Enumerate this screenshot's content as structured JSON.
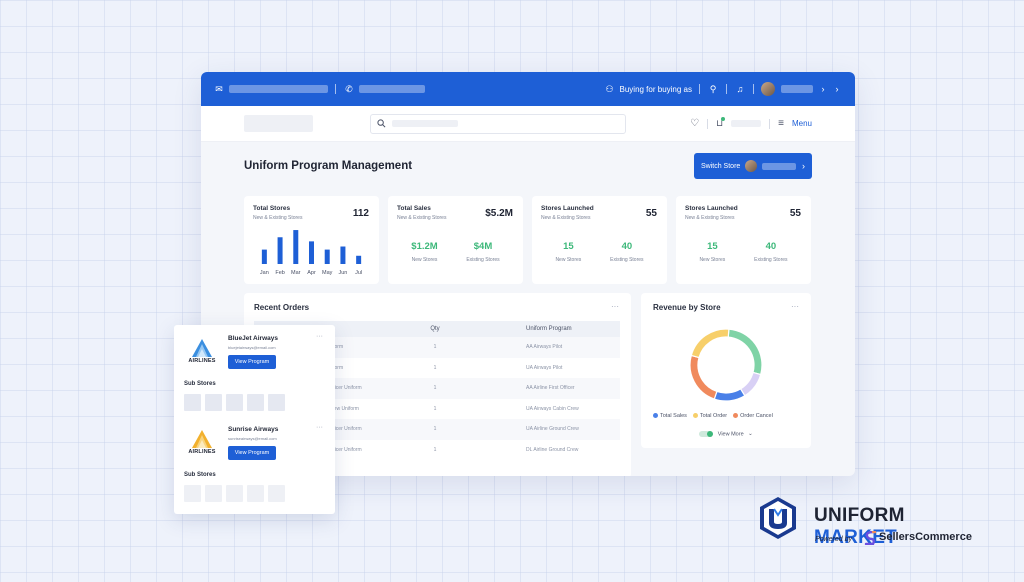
{
  "topbar": {
    "buying_for": "Buying for buying as"
  },
  "navbar": {
    "menu_label": "Menu"
  },
  "page": {
    "title": "Uniform Program Management",
    "switch_store_label": "Switch Store"
  },
  "kpis": [
    {
      "title": "Total Stores",
      "subtitle": "New & Existing Stores",
      "value": "112"
    },
    {
      "title": "Total Sales",
      "subtitle": "New & Existing Stores",
      "value": "$5.2M",
      "left_num": "$1.2M",
      "left_label": "New Stores",
      "right_num": "$4M",
      "right_label": "Existing Stores"
    },
    {
      "title": "Stores Launched",
      "subtitle": "New & Existing Stores",
      "value": "55",
      "left_num": "15",
      "left_label": "New Stores",
      "right_num": "40",
      "right_label": "Existing Stores"
    },
    {
      "title": "Stores Launched",
      "subtitle": "New & Existing Stores",
      "value": "55",
      "left_num": "15",
      "left_label": "New Stores",
      "right_num": "40",
      "right_label": "Existing Stores"
    }
  ],
  "chart_data": [
    {
      "type": "bar",
      "categories": [
        "Jan",
        "Feb",
        "Mar",
        "Apr",
        "May",
        "Jun",
        "Jul"
      ],
      "values": [
        14,
        26,
        33,
        22,
        14,
        17,
        8
      ],
      "ylim": [
        0,
        35
      ]
    },
    {
      "type": "pie",
      "categories": [
        "Total Sales",
        "Total Order",
        "Order Cancel"
      ],
      "legend_placement": "bottom",
      "segments": [
        {
          "color": "#7fd3a6",
          "value": 28
        },
        {
          "color": "#d8d0f5",
          "value": 12
        },
        {
          "color": "#4a80e8",
          "value": 14
        },
        {
          "color": "#f08a5d",
          "value": 24
        },
        {
          "color": "#f7cf6a",
          "value": 22
        }
      ]
    }
  ],
  "recent_orders": {
    "title": "Recent Orders",
    "columns": [
      "Qty",
      "Uniform Program"
    ],
    "rows": [
      {
        "item": "iform",
        "qty": "1",
        "program": "AA Airways Pilot"
      },
      {
        "item": "iform",
        "qty": "1",
        "program": "UA Airways Pilot"
      },
      {
        "item": "fficer Uniform",
        "qty": "1",
        "program": "AA Airline First Officer"
      },
      {
        "item": "rew Uniform",
        "qty": "1",
        "program": "UA Airways Cabin Crew"
      },
      {
        "item": "fficer Uniform",
        "qty": "1",
        "program": "UA Airline Ground Crew"
      },
      {
        "item": "fficer Uniform",
        "qty": "1",
        "program": "DL Airline Ground Crew"
      }
    ]
  },
  "revenue": {
    "title": "Revenue by Store",
    "legend": [
      {
        "label": "Total Sales",
        "color": "#4a80e8"
      },
      {
        "label": "Total Order",
        "color": "#f7cf6a"
      },
      {
        "label": "Order Cancel",
        "color": "#f08a5d"
      }
    ],
    "view_more": "View More"
  },
  "airlines": [
    {
      "logo_word": "AIRLINES",
      "name": "BlueJet Airways",
      "email": "bluejetairways@email.com",
      "button": "View Program",
      "sub_title": "Sub Stores",
      "color": "#3b8fe0"
    },
    {
      "logo_word": "AIRLINES",
      "name": "Sunrise Airways",
      "email": "sunriseairways@email.com",
      "button": "View Program",
      "sub_title": "Sub Stores",
      "color": "#f2b12e"
    }
  ],
  "brand": {
    "name_dark": "UNIFORM ",
    "name_blue": "MARKET",
    "powered_by": "Powered by",
    "partner": "SellersCommerce"
  }
}
